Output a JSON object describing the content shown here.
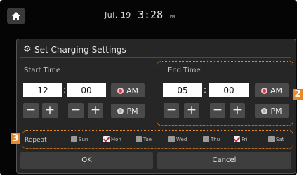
{
  "status_bar": {
    "date": "Jul. 19",
    "time": "3:28",
    "ampm": "PM"
  },
  "panel": {
    "title": "Set Charging Settings"
  },
  "start_time": {
    "label": "Start Time",
    "hour": "12",
    "minute": "00",
    "am_label": "AM",
    "pm_label": "PM",
    "selected": "AM"
  },
  "end_time": {
    "label": "End Time",
    "hour": "05",
    "minute": "00",
    "am_label": "AM",
    "pm_label": "PM",
    "selected": "AM"
  },
  "colon": ":",
  "steppers": {
    "minus": "−",
    "plus": "+"
  },
  "callouts": {
    "end_time_tag": "2",
    "repeat_tag": "3"
  },
  "repeat": {
    "label": "Repeat",
    "days": [
      {
        "label": "Sun",
        "checked": false
      },
      {
        "label": "Mon",
        "checked": true
      },
      {
        "label": "Tue",
        "checked": false
      },
      {
        "label": "Wed",
        "checked": false
      },
      {
        "label": "Thu",
        "checked": false
      },
      {
        "label": "Fri",
        "checked": true
      },
      {
        "label": "Sat",
        "checked": false
      }
    ]
  },
  "buttons": {
    "ok": "OK",
    "cancel": "Cancel"
  },
  "colors": {
    "accent": "#e8892a",
    "radio_selected": "#e0344a",
    "background": "#050505",
    "panel": "#262626"
  }
}
